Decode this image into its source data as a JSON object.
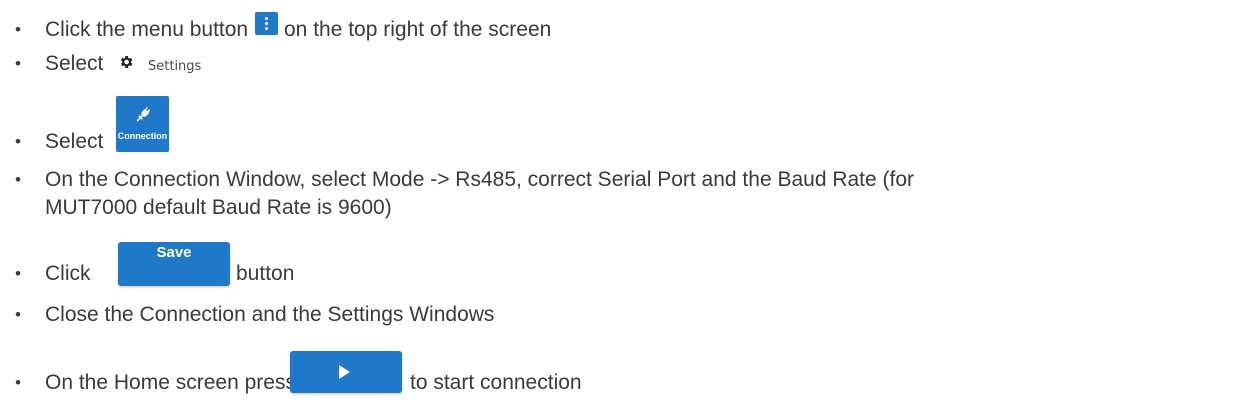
{
  "bullet": "•",
  "steps": [
    {
      "before": "Click the menu button",
      "after": "on the top right of the screen",
      "icon": "kebab-menu-icon"
    },
    {
      "before": "Select",
      "icon": "gear-icon",
      "icon_label": "Settings"
    },
    {
      "before": "Select",
      "icon": "plug-icon",
      "icon_label": "Connection"
    },
    {
      "line1": "On the Connection Window, select Mode -> Rs485, correct Serial Port and the Baud Rate (for",
      "line2": "MUT7000 default Baud Rate is 9600)"
    },
    {
      "before": "Click",
      "button_label": "Save",
      "after": "button"
    },
    {
      "text": "Close the Connection and the Settings Windows"
    },
    {
      "before": "On the Home screen press",
      "icon": "play-icon",
      "after": "to start connection"
    }
  ],
  "colors": {
    "accent": "#1f78c8",
    "text": "#3a3a3a"
  }
}
